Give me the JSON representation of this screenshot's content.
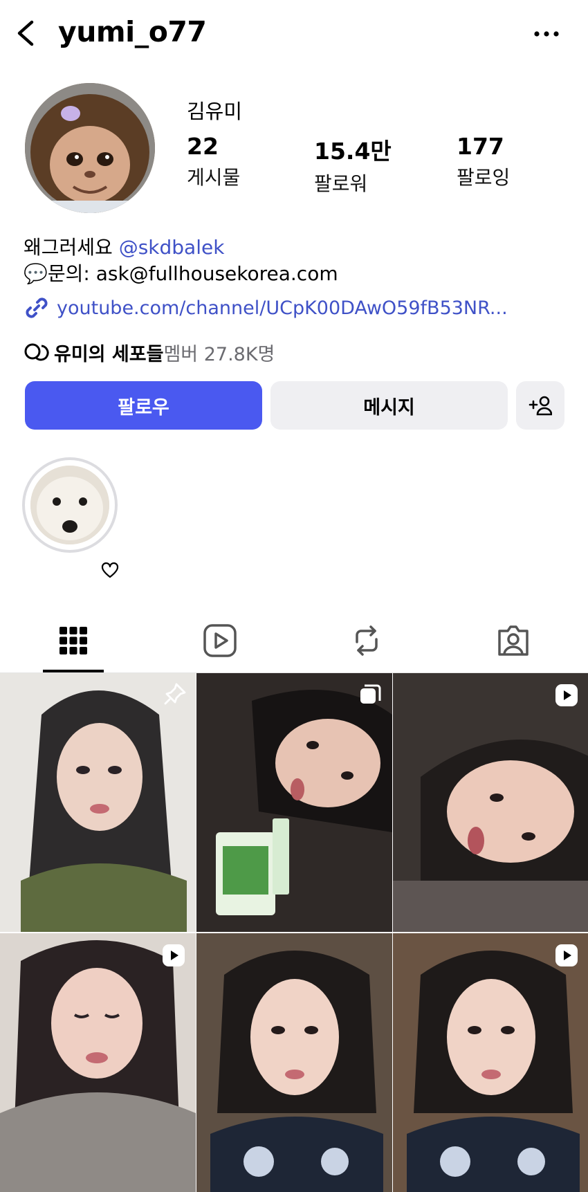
{
  "header": {
    "username": "yumi_o77"
  },
  "profile": {
    "full_name": "김유미",
    "stats": [
      {
        "value": "22",
        "label": "게시물"
      },
      {
        "value": "15.4만",
        "label": "팔로워"
      },
      {
        "value": "177",
        "label": "팔로잉"
      }
    ],
    "bio_line1_text": "왜그러세요 ",
    "bio_mention": "@skdbalek",
    "bio_line2": "💬문의: ask@fullhousekorea.com",
    "link": "youtube.com/channel/UCpK00DAwO59fB53NR...",
    "community_name": "유미의 세포들",
    "community_members": " 멤버 27.8K명"
  },
  "actions": {
    "follow": "팔로우",
    "message": "메시지"
  },
  "colors": {
    "accent": "#4a59f0",
    "link": "#3f51c7",
    "button_bg": "#efeff2"
  },
  "tabs": [
    {
      "icon": "grid-icon",
      "active": true
    },
    {
      "icon": "reels-icon",
      "active": false
    },
    {
      "icon": "reposts-icon",
      "active": false
    },
    {
      "icon": "tagged-icon",
      "active": false
    }
  ],
  "posts": [
    {
      "badge": "pin-icon"
    },
    {
      "badge": "carousel-icon"
    },
    {
      "badge": "reel-icon"
    },
    {
      "badge": "reel-icon"
    },
    {
      "badge": "none"
    },
    {
      "badge": "reel-icon"
    }
  ]
}
